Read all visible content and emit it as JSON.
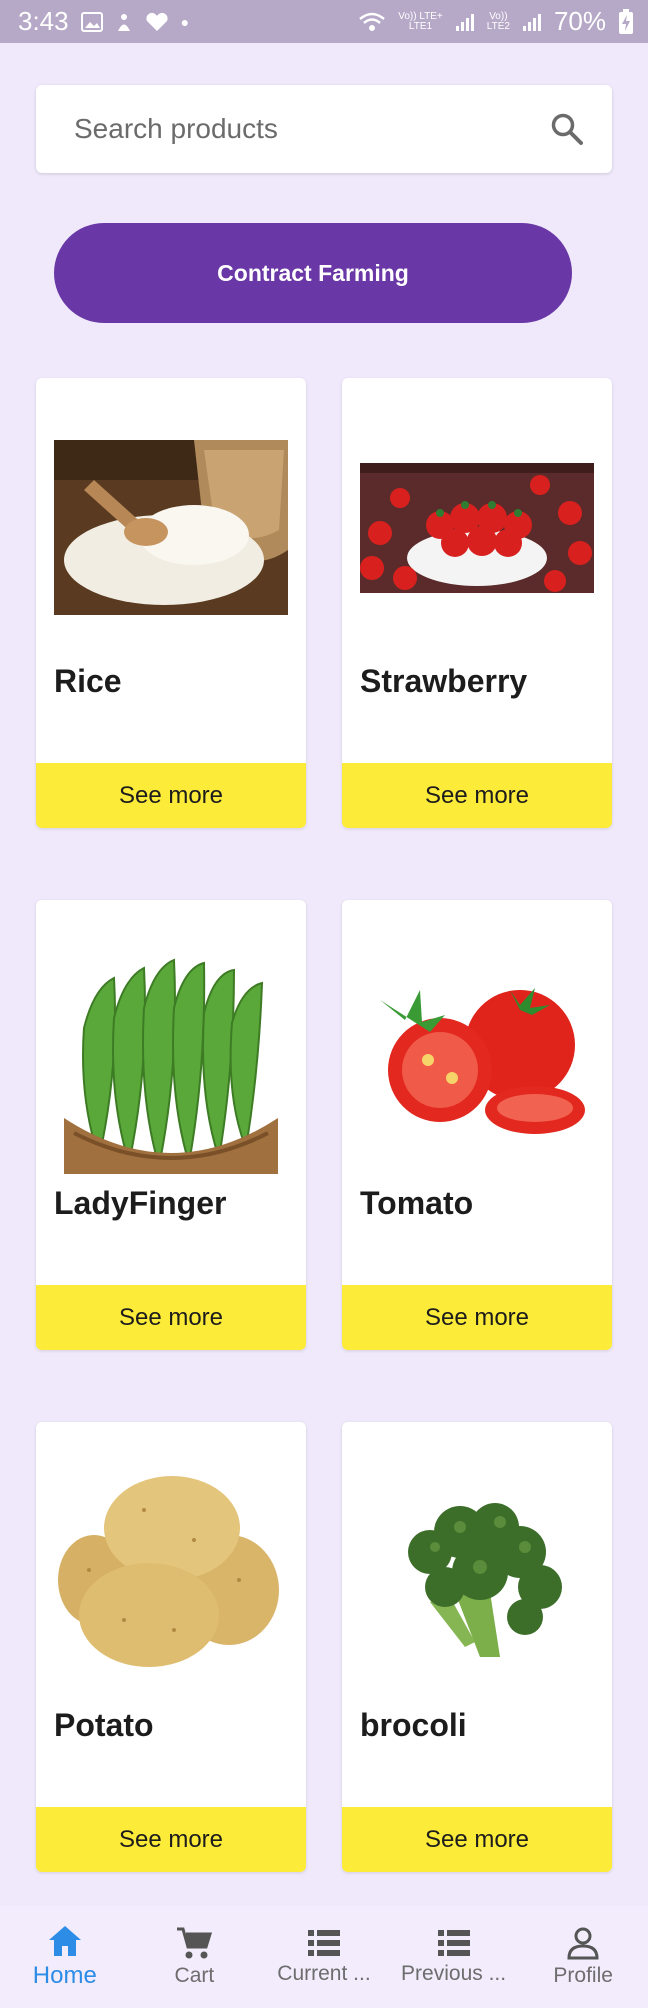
{
  "status_bar": {
    "time": "3:43",
    "battery": "70%",
    "sim1_top": "Vo)) LTE+",
    "sim1_bottom": "LTE1",
    "sim2_top": "Vo))",
    "sim2_bottom": "LTE2"
  },
  "search": {
    "placeholder": "Search products"
  },
  "contract_button": {
    "label": "Contract Farming"
  },
  "products": [
    {
      "name": "Rice",
      "action": "See more"
    },
    {
      "name": "Strawberry",
      "action": "See more"
    },
    {
      "name": "LadyFinger",
      "action": "See more"
    },
    {
      "name": "Tomato",
      "action": "See more"
    },
    {
      "name": "Potato",
      "action": "See more"
    },
    {
      "name": "brocoli",
      "action": "See more"
    }
  ],
  "bottom_nav": [
    {
      "label": "Home",
      "icon": "home-icon"
    },
    {
      "label": "Cart",
      "icon": "cart-icon"
    },
    {
      "label": "Current ...",
      "icon": "list-icon"
    },
    {
      "label": "Previous ...",
      "icon": "list-icon"
    },
    {
      "label": "Profile",
      "icon": "person-icon"
    }
  ],
  "colors": {
    "background": "#efe9fb",
    "primary_purple": "#6a38a6",
    "see_more_yellow": "#fdeb3a",
    "nav_active": "#2c8ce6"
  }
}
